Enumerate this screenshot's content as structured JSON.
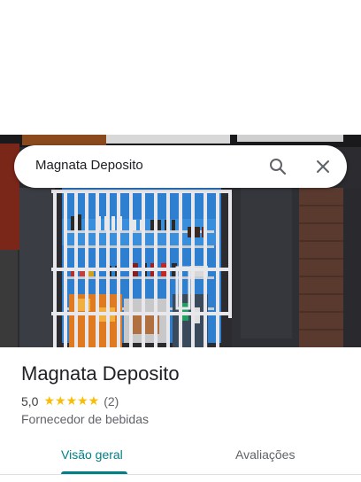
{
  "search": {
    "query": "Magnata Deposito"
  },
  "place": {
    "name": "Magnata Deposito",
    "rating": "5,0",
    "stars": "★★★★★",
    "review_count": "(2)",
    "category": "Fornecedor de bebidas"
  },
  "tabs": [
    {
      "label": "Visão geral",
      "active": true
    },
    {
      "label": "Avaliações",
      "active": false
    }
  ],
  "colors": {
    "accent": "#017f86",
    "star": "#fbbc04"
  },
  "icons": [
    "search-icon",
    "close-icon"
  ]
}
